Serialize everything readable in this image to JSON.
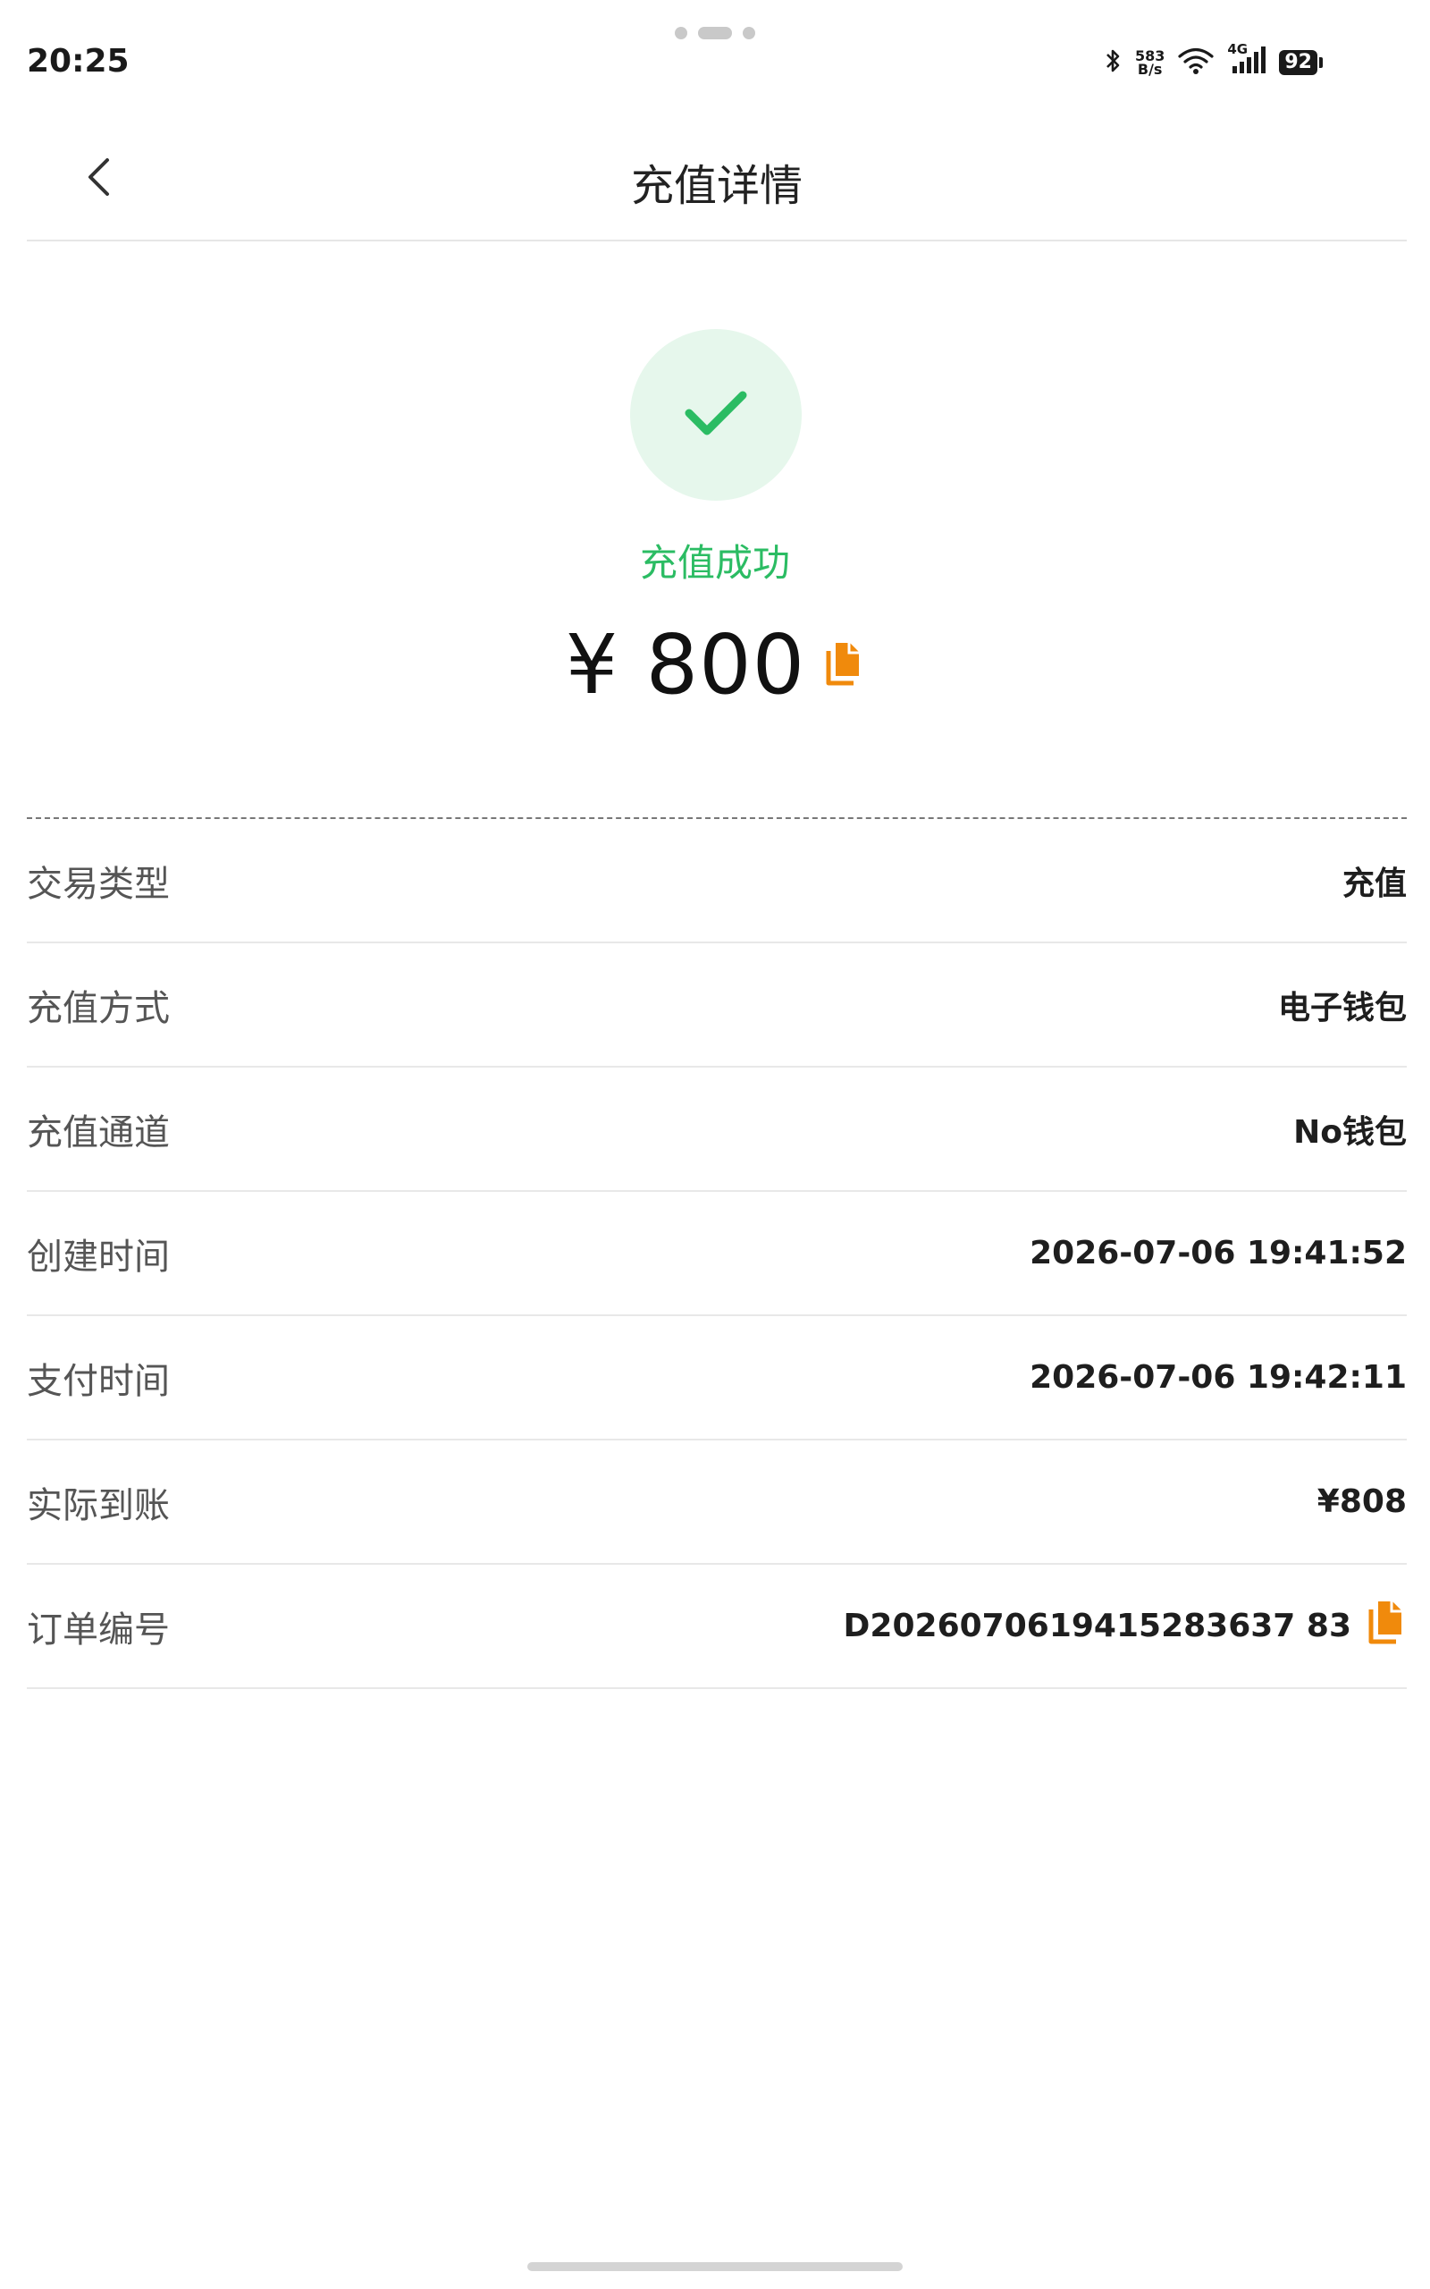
{
  "status_bar": {
    "time": "20:25",
    "net_speed_value": "583",
    "net_speed_unit": "B/s",
    "signal_label": "4G",
    "battery": "92"
  },
  "header": {
    "title": "充值详情"
  },
  "result": {
    "status_text": "充值成功",
    "amount": "¥ 800",
    "status_color": "#2bbc63",
    "copy_icon_color": "#f08a0c"
  },
  "details": {
    "rows": [
      {
        "label": "交易类型",
        "value": "充值"
      },
      {
        "label": "充值方式",
        "value": "电子钱包"
      },
      {
        "label": "充值通道",
        "value": "No钱包"
      },
      {
        "label": "创建时间",
        "value": "2026-07-06 19:41:52"
      },
      {
        "label": "支付时间",
        "value": "2026-07-06 19:42:11"
      },
      {
        "label": "实际到账",
        "value": "¥808"
      },
      {
        "label": "订单编号",
        "value": "D2026070619415283637 83"
      }
    ]
  }
}
